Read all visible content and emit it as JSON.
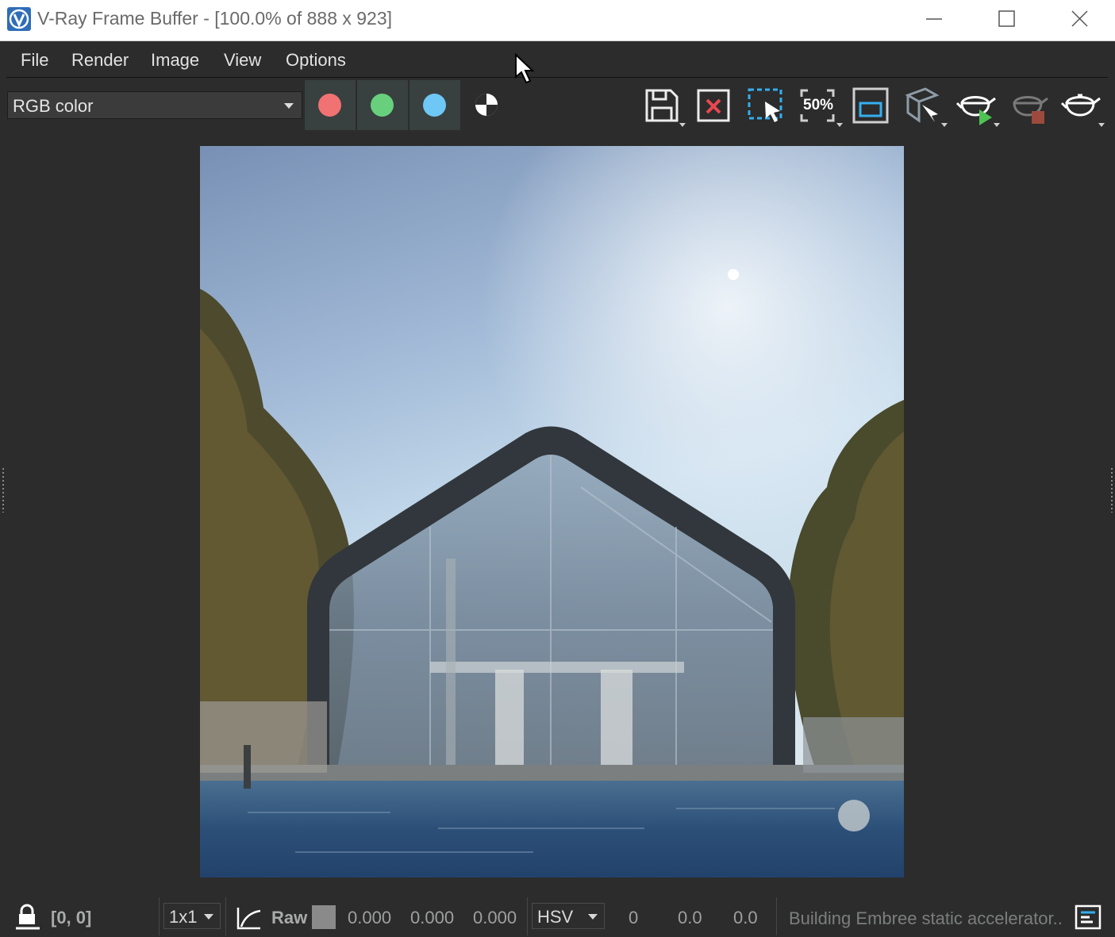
{
  "window": {
    "title": "V-Ray Frame Buffer - [100.0% of 888 x 923]",
    "app_icon": "vray-logo-icon"
  },
  "menu": {
    "items": [
      "File",
      "Render",
      "Image",
      "View",
      "Options"
    ]
  },
  "toolbar": {
    "channel": "RGB color",
    "channel_buttons": [
      {
        "name": "red-channel",
        "color": "#f07272"
      },
      {
        "name": "green-channel",
        "color": "#68d07c"
      },
      {
        "name": "blue-channel",
        "color": "#6ec7f4"
      }
    ],
    "zoom_label": "50%",
    "icons": [
      "save-image-icon",
      "clear-image-icon",
      "region-render-icon",
      "zoom-50-icon",
      "track-mouse-icon",
      "render-camera-icon",
      "start-render-icon",
      "stop-render-icon",
      "render-teapot-icon"
    ]
  },
  "render": {
    "scene": "Glass house with pool and trees"
  },
  "status": {
    "coords": "[0, 0]",
    "sample_size": "1x1",
    "mode": "Raw",
    "rgb": [
      "0.000",
      "0.000",
      "0.000"
    ],
    "color_space": "HSV",
    "hsv": [
      "0",
      "0.0",
      "0.0"
    ],
    "message": "Building Embree static accelerator.."
  },
  "colors": {
    "background": "#2b2c2b",
    "titlebar": "#ffffff",
    "accent_blue": "#35aef0"
  }
}
